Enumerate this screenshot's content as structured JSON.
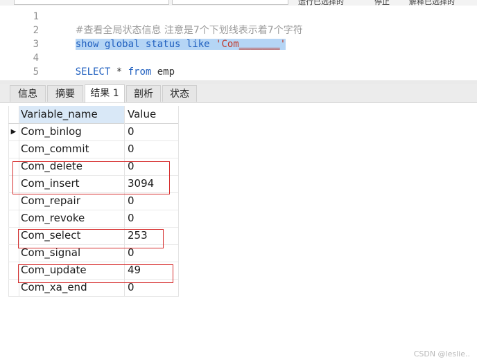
{
  "toolbar_partial": {
    "text_fragment": "运行已选择的",
    "text_fragment2": "停止",
    "text_fragment3": "解释已选择的"
  },
  "editor": {
    "lines": [
      {
        "no": "1",
        "comment": "#查看全局状态信息 注意是7个下划线表示着7个字符"
      },
      {
        "no": "2",
        "kw": "show global status like ",
        "str": "'Com",
        "str_u": "_______",
        "str_end": "'"
      },
      {
        "no": "3"
      },
      {
        "no": "4",
        "kw1": "SELECT",
        "op": " * ",
        "kw2": "from",
        "ident": " emp"
      },
      {
        "no": "5"
      }
    ]
  },
  "tabs": [
    {
      "label": "信息"
    },
    {
      "label": "摘要"
    },
    {
      "label": "结果 1",
      "active": true
    },
    {
      "label": "剖析"
    },
    {
      "label": "状态"
    }
  ],
  "grid": {
    "columns": [
      "Variable_name",
      "Value"
    ],
    "rows": [
      {
        "name": "Com_binlog",
        "value": "0",
        "current": true
      },
      {
        "name": "Com_commit",
        "value": "0"
      },
      {
        "name": "Com_delete",
        "value": "0"
      },
      {
        "name": "Com_insert",
        "value": "3094"
      },
      {
        "name": "Com_repair",
        "value": "0"
      },
      {
        "name": "Com_revoke",
        "value": "0"
      },
      {
        "name": "Com_select",
        "value": "253"
      },
      {
        "name": "Com_signal",
        "value": "0"
      },
      {
        "name": "Com_update",
        "value": "49"
      },
      {
        "name": "Com_xa_end",
        "value": "0"
      }
    ],
    "current_row_marker": "▶"
  },
  "watermark": "CSDN @leslie..",
  "colors": {
    "annotation_red": "#d62d2d",
    "selection": "#b5d5f5",
    "keyword": "#1f5fbf",
    "string": "#c0392b"
  }
}
